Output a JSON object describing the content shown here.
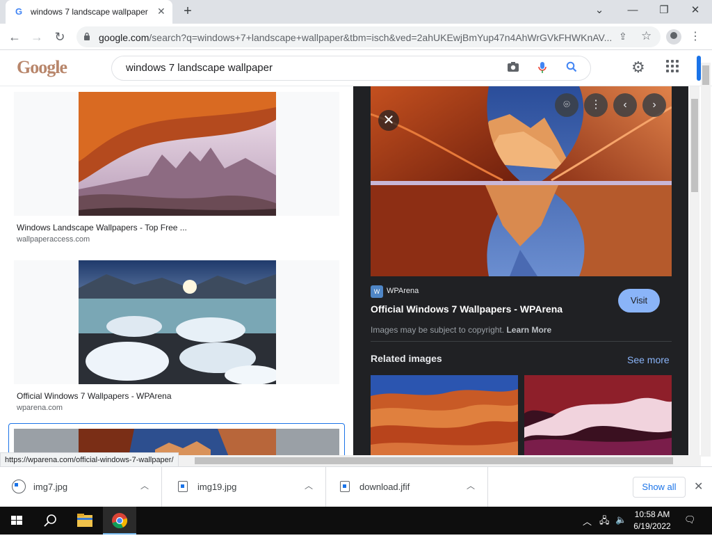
{
  "browser": {
    "tab_title": "windows 7 landscape wallpaper",
    "tab_close": "✕",
    "new_tab": "+",
    "window_controls": {
      "tab_search": "⌄",
      "minimize": "—",
      "restore": "❐",
      "close": "✕"
    },
    "url_host": "google.com",
    "url_path": "/search?q=windows+7+landscape+wallpaper&tbm=isch&ved=2ahUKEwjBmYup47n4AhWrGVkFHWKnAV...",
    "status_url": "https://wparena.com/official-windows-7-wallpaper/"
  },
  "google": {
    "logo_text": "Google",
    "search_value": "windows 7 landscape wallpaper"
  },
  "results": [
    {
      "title": "Windows Landscape Wallpapers - Top Free ...",
      "source": "wallpaperaccess.com"
    },
    {
      "title": "Official Windows 7 Wallpapers - WPArena",
      "source": "wparena.com"
    }
  ],
  "preview": {
    "source_name": "WPArena",
    "source_icon_text": "W",
    "title": "Official Windows 7 Wallpapers - WPArena",
    "visit_label": "Visit",
    "copyright_text": "Images may be subject to copyright.",
    "learn_more": "Learn More",
    "related_heading": "Related images",
    "see_more": "See more"
  },
  "downloads": [
    {
      "name": "img7.jpg"
    },
    {
      "name": "img19.jpg"
    },
    {
      "name": "download.jfif"
    }
  ],
  "shelf": {
    "show_all": "Show all"
  },
  "taskbar": {
    "time": "10:58 AM",
    "date": "6/19/2022"
  },
  "colors": {
    "accent": "#1a73e8",
    "visit_button": "#8ab4f8",
    "preview_bg": "#202124"
  }
}
